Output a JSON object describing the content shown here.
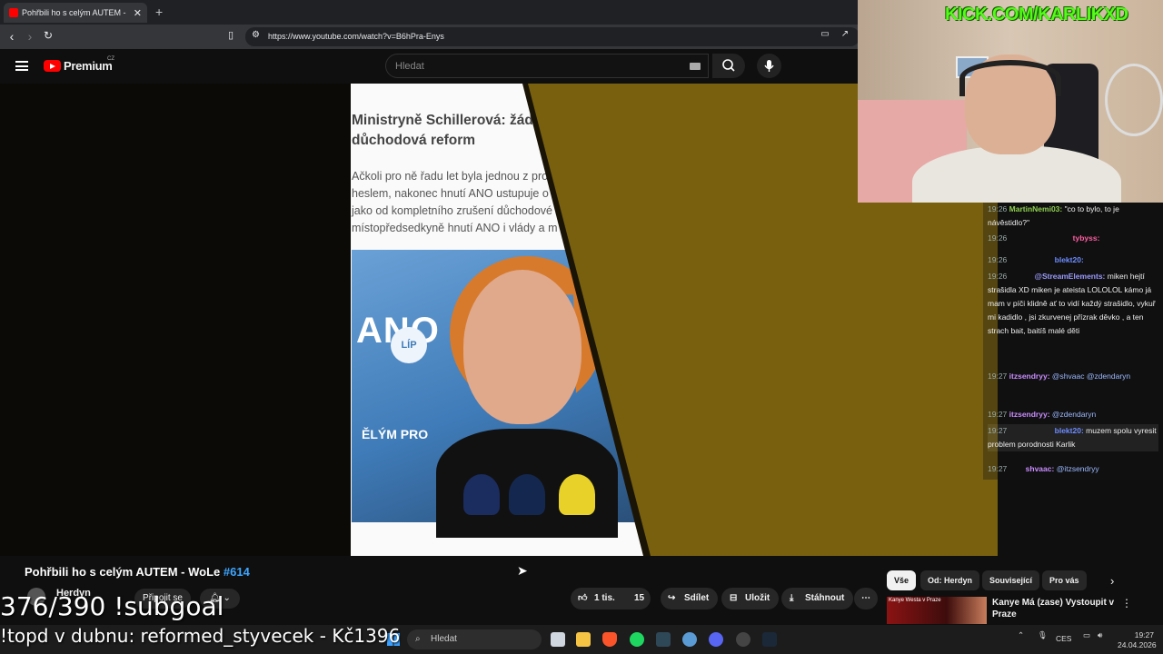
{
  "browser": {
    "tab_title": "Pohřbili ho s celým AUTEM -",
    "tab_close": "✕",
    "new_tab": "+",
    "url": "https://www.youtube.com/watch?v=B6hPra-Enys"
  },
  "youtube": {
    "brand": "Premium",
    "region": "CZ",
    "search_placeholder": "Hledat"
  },
  "article": {
    "title": "Ministryně Schillerová: žádná důchodová reform",
    "body": "Ačkoli pro ně řadu let byla jednou z pro heslem, nakonec hnutí ANO ustupuje o jako od kompletního zrušení důchodové místopředsedkyně hnutí ANO i vlády a m",
    "logo_text": "ANO",
    "banner_lip": "LÍP",
    "banner_vym": "ĚLÝM PRO"
  },
  "stream": {
    "kick_url": "KICK.COM/KARLIKXD"
  },
  "chat": [
    {
      "time": "19:26",
      "user": "MartinNemi03:",
      "user_color": "#8fd14f",
      "text": "\"co to bylo, to je návěstidlo?\""
    },
    {
      "time": "19:26",
      "user": "tybyss:",
      "user_color": "#ff5fa2",
      "text": ""
    },
    {
      "time": "19:26",
      "user": "blekt20:",
      "user_color": "#6c8cff",
      "text": ""
    },
    {
      "time": "19:26",
      "user": "@StreamElements:",
      "user_color": "#9b9bff",
      "text": "miken hejtí strašidla XD miken je ateista LOLOLOL kámo já mam v píči klidně ať to vidí každý strašidlo, vykuř mi kadidlo , jsi zkurvenej přízrak děvko , a ten strach bait, baitíš malé děti"
    },
    {
      "time": "19:27",
      "user": "itzsendryy:",
      "user_color": "#c98cff",
      "text": "@shvaac @zdendaryn"
    },
    {
      "time": "19:27",
      "user": "itzsendryy:",
      "user_color": "#c98cff",
      "text": "@zdendaryn"
    },
    {
      "time": "19:27",
      "user": "blekt20:",
      "user_color": "#6c8cff",
      "text": "muzem spolu vyresit problem porodnosti Karlik"
    },
    {
      "time": "19:27",
      "user": "shvaac:",
      "user_color": "#c98cff",
      "text": "@itzsendryy"
    }
  ],
  "video": {
    "title": "Pohřbili ho s celým AUTEM - WoLe",
    "episode": "#614",
    "channel": "Herdyn",
    "join_label": "Připojit se",
    "likes": "1 tis.",
    "comments": "15",
    "share": "Sdílet",
    "save": "Uložit",
    "download": "Stáhnout",
    "more": "⋯"
  },
  "overlays": {
    "subgoal": "376/390 !subgoal",
    "topdonor": "!topd v dubnu: reformed_styvecek - Kč1396"
  },
  "chips": [
    "Vše",
    "Od: Herdyn",
    "Související",
    "Pro vás"
  ],
  "recommendation": {
    "title": "Kanye Má (zase) Vystoupit v Praze",
    "thumb_text": "Kanye Westa v Praze"
  },
  "taskbar": {
    "search": "Hledat",
    "lang": "CES",
    "time": "19:27",
    "date": "24.04.2026"
  }
}
